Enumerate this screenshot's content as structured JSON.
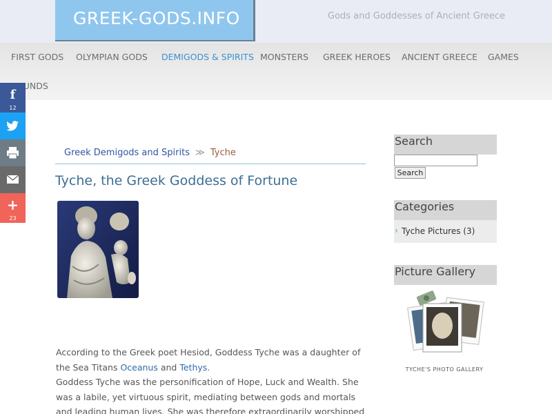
{
  "header": {
    "logo": "GREEK-GODS.INFO",
    "tagline": "Gods and Goddesses of Ancient Greece"
  },
  "nav": {
    "items": [
      {
        "label": "FIRST GODS"
      },
      {
        "label": "OLYMPIAN GODS"
      },
      {
        "label": "DEMIGODS & SPIRITS",
        "active": true
      },
      {
        "label": "MONSTERS"
      },
      {
        "label": "GREEK HEROES"
      },
      {
        "label": "ANCIENT GREECE"
      },
      {
        "label": "GAMES"
      },
      {
        "label": "SOUNDS"
      }
    ]
  },
  "share": {
    "facebook_count": "12",
    "more_count": "23",
    "colors": {
      "facebook": "#3b5998",
      "twitter": "#1da1f2",
      "print": "#6e7d85",
      "email": "#6a6a6a",
      "more": "#f0645a"
    }
  },
  "breadcrumb": {
    "parent": "Greek Demigods and Spirits",
    "separator": "≫",
    "current": "Tyche"
  },
  "page": {
    "title": "Tyche, the Greek Goddess of Fortune"
  },
  "article": {
    "p1_a": "According to the Greek poet Hesiod, Goddess Tyche was a daughter of the Sea Titans ",
    "link1": "Oceanus",
    "p1_and": " and ",
    "link2": "Tethys",
    "p1_end": ".",
    "p2": "Goddess Tyche was the personification of Hope, Luck and Wealth. She was a labile, yet virtuous spirit, mediating between gods and mortals and leading human lives. She was therefore extraordinarily worshipped by the ancient Greeks."
  },
  "sidebar": {
    "search_heading": "Search",
    "search_button": "Search",
    "categories_heading": "Categories",
    "category_item": "Tyche Pictures (3)",
    "gallery_heading": "Picture Gallery",
    "gallery_caption": "TYCHE'S PHOTO GALLERY"
  }
}
